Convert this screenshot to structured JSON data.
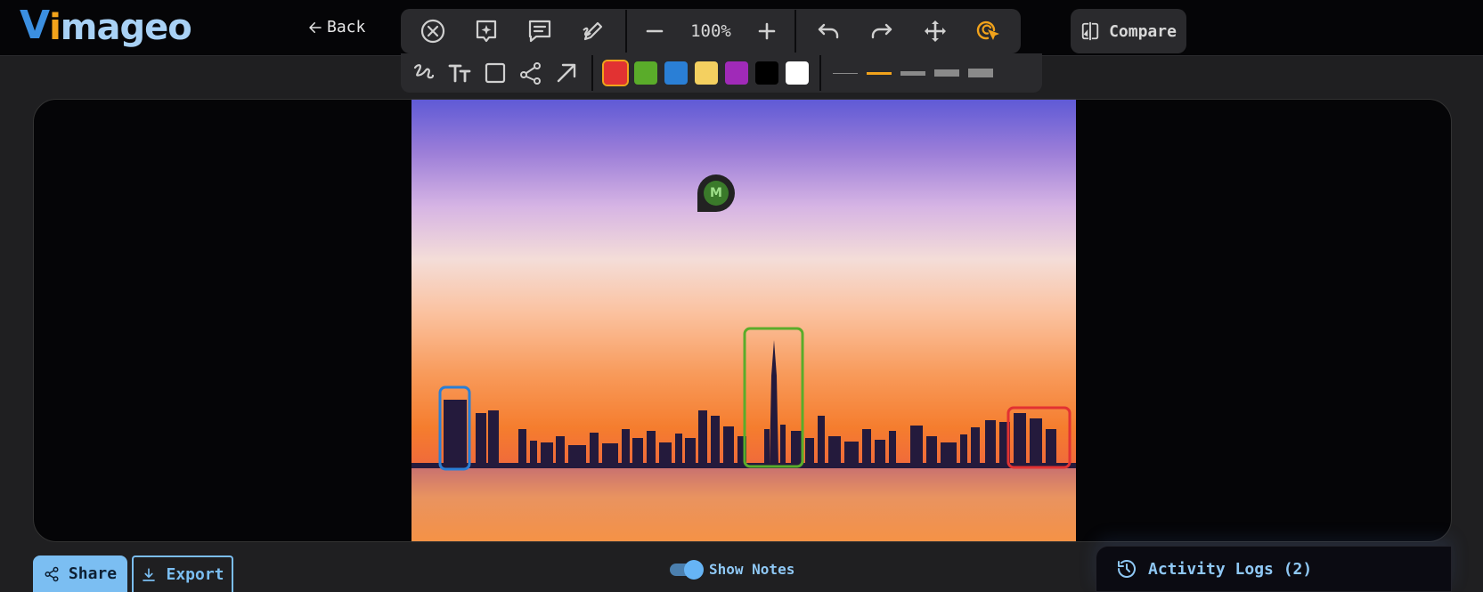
{
  "app": {
    "logo_v": "V",
    "logo_i": "i",
    "logo_rest": "mageo"
  },
  "nav": {
    "back_label": "Back"
  },
  "toolbar": {
    "icons": [
      "close-circle-icon",
      "sparkle-icon",
      "comment-icon",
      "draw-pencil-icon"
    ],
    "zoom_value": "100%",
    "zoom_out_icon": "minus-icon",
    "zoom_in_icon": "plus-icon",
    "history_icons": [
      "undo-icon",
      "redo-icon",
      "move-icon",
      "cursor-select-icon"
    ],
    "active_tool_color": "#f2a31b"
  },
  "annotate_tools": {
    "tools": [
      "freehand-icon",
      "text-icon",
      "rectangle-icon",
      "connector-icon",
      "arrow-icon"
    ],
    "colors": [
      "#e23232",
      "#5aac2a",
      "#2a7fd6",
      "#f4d060",
      "#a02ab8",
      "#000000",
      "#ffffff"
    ],
    "selected_color": "#e23232",
    "line_weights": [
      1,
      2,
      4,
      6,
      8
    ],
    "selected_line_weight": 2
  },
  "compare": {
    "label": "Compare"
  },
  "canvas": {
    "annotations": [
      {
        "color": "#2a7fd6",
        "shape": "rectangle"
      },
      {
        "color": "#5aac2a",
        "shape": "rectangle"
      },
      {
        "color": "#e23232",
        "shape": "rectangle"
      }
    ],
    "note_marker_letter": "M"
  },
  "footer": {
    "share_label": "Share",
    "export_label": "Export",
    "show_notes_label": "Show Notes",
    "show_notes_on": true,
    "activity_logs_label": "Activity Logs (2)"
  }
}
